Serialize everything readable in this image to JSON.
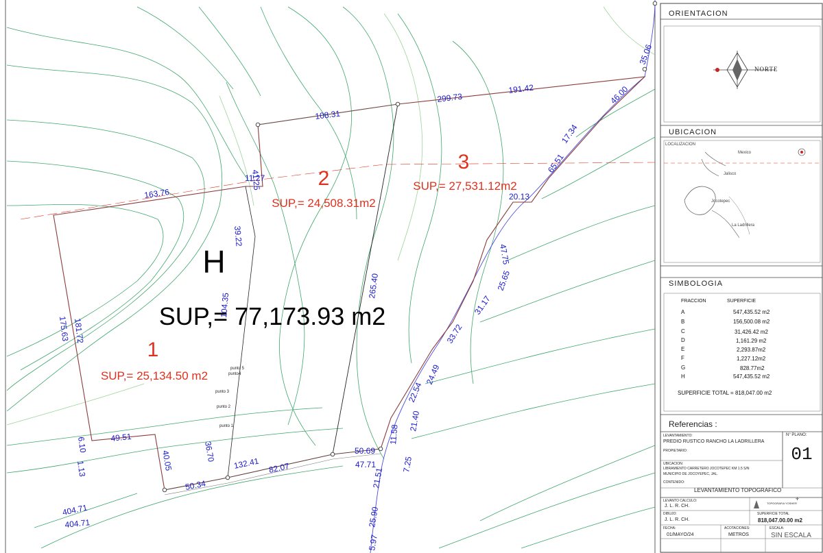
{
  "map": {
    "fractions": [
      {
        "number": "1",
        "area": "SUP,= 25,134.50 m2"
      },
      {
        "number": "2",
        "area": "SUP,= 24,508.31m2"
      },
      {
        "number": "3",
        "area": "SUP,= 27,531.12m2"
      }
    ],
    "main_label": "H",
    "main_area": "SUP,= 77,173.93 m2",
    "distances": [
      "163.76",
      "175.63",
      "181.72",
      "6.10",
      "49.51",
      "1.13",
      "40.05",
      "50.34",
      "36.70",
      "132.41",
      "82.07",
      "50.69",
      "47.71",
      "21.51",
      "11.58",
      "7.25",
      "21.40",
      "25.90",
      "5.97",
      "22.54",
      "24.49",
      "33.72",
      "31.17",
      "25.65",
      "47.75",
      "20.13",
      "65.51",
      "17.34",
      "46.00",
      "35.06",
      "191.42",
      "299.73",
      "108.31",
      "41.25",
      "11.27",
      "39.22",
      "104.35",
      "265.40",
      "404.71",
      "404.71"
    ],
    "points": [
      "punto 5",
      "punto4",
      "punto 3",
      "punto 2",
      "punto 1"
    ]
  },
  "orientation": {
    "title": "ORIENTACION",
    "north_label": "NORTE"
  },
  "location": {
    "title": "UBICACION",
    "subtitle": "LOCALIZACION",
    "places": [
      "Mexico",
      "Jalisco",
      "Jocotepec",
      "La Ladrillera"
    ]
  },
  "legend": {
    "title": "SIMBOLOGIA",
    "col_fraction": "FRACCION",
    "col_area": "SUPERFICIE",
    "rows": [
      {
        "f": "A",
        "s": "547,435.52 m2"
      },
      {
        "f": "B",
        "s": "156,500.08 m2"
      },
      {
        "f": "C",
        "s": "31,426.42 m2"
      },
      {
        "f": "D",
        "s": "1,161.29 m2"
      },
      {
        "f": "E",
        "s": "2,293.87m2"
      },
      {
        "f": "F",
        "s": "1,227.12m2"
      },
      {
        "f": "G",
        "s": "828.77m2"
      },
      {
        "f": "H",
        "s": "547,435.52 m2"
      }
    ],
    "total": "SUPERFICIE TOTAL = 818,047.00 m2"
  },
  "references": {
    "title": "Referencias :",
    "levantamiento_label": "LEVANTAMIENTO:",
    "levantamiento": "PREDIO RUSTICO RANCHO LA LADRILLERA",
    "propietario_label": "PROPIETARIO:",
    "plano_label": "N° PLANO:",
    "plano": "01",
    "ubicacion_label": "UBICACION:",
    "ubicacion_1": "LIBRAMIENTO CARRETERO JOCOTEPEC KM 1.5 S/N",
    "ubicacion_2": "MUNICIPIO DE JOCOYEPEC, JAL.",
    "contenido_label": "CONTENIDO:",
    "contenido": "LEVANTAMIENTO TOPOGRAFICO",
    "calculo_label": "LEVANTO CALCULO:",
    "calculo": "J. L. R. CH.",
    "firm": "TOPOGRAFIA YOSHER",
    "dibujo_label": "DIBUJO:",
    "dibujo": "J. L. R. CH.",
    "superficie_label": "SUPERFICIE TOTAL",
    "superficie": "818,047.00.00  m2",
    "fecha_label": "FECHA:",
    "fecha": "01/MAYO/24",
    "acot_label": "ACOTACIONES:",
    "acot": "METROS",
    "escala_label": "ESCALA:",
    "escala": "SIN  ESCALA"
  },
  "colors": {
    "dimension": "#1a1acd",
    "fraction": "#e0301e",
    "boundary": "#8b3a3a",
    "contour": "#3ea66a",
    "light_contour": "#9cd39b"
  }
}
